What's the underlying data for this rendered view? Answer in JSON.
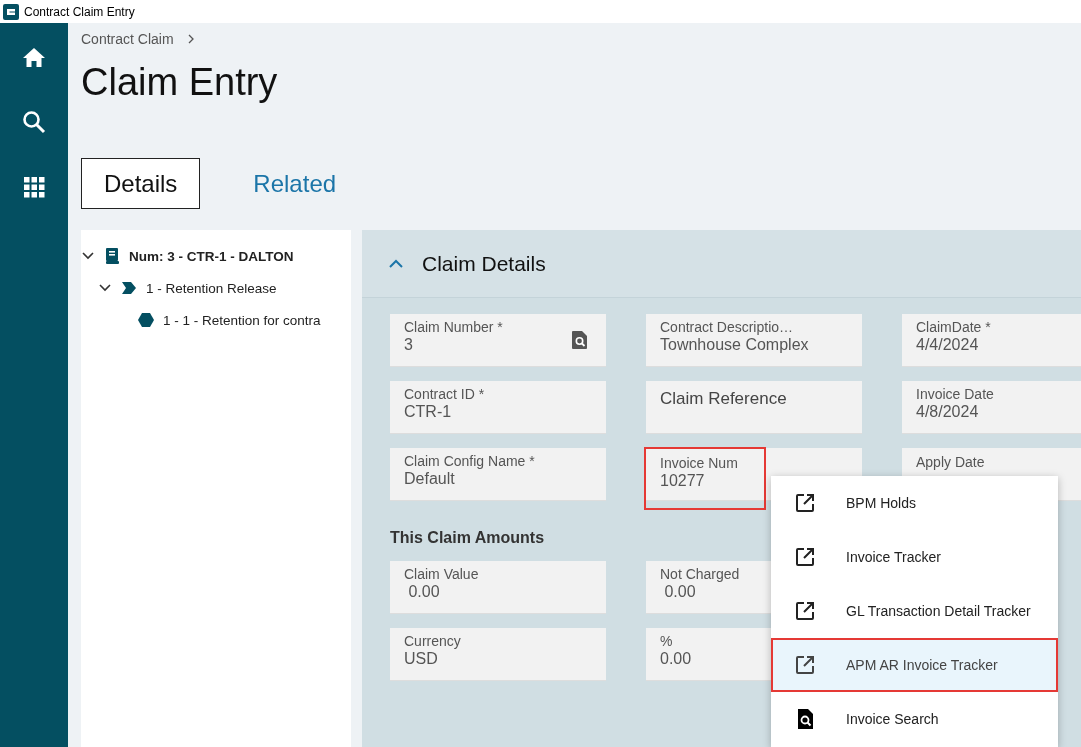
{
  "window": {
    "title": "Contract Claim Entry"
  },
  "nav": [
    {
      "kind": "home"
    },
    {
      "kind": "search"
    },
    {
      "kind": "apps"
    }
  ],
  "breadcrumb": [
    "Contract Claim"
  ],
  "page_title": "Claim Entry",
  "tabs": [
    {
      "label": "Details",
      "selected": true
    },
    {
      "label": "Related",
      "selected": false
    }
  ],
  "tree": [
    {
      "label": "Num: 3 - CTR-1 - DALTON",
      "kind": "claim",
      "expanded": true,
      "children": [
        {
          "label": "1 - Retention Release",
          "kind": "line",
          "expanded": true,
          "children": [
            {
              "label": "1 - 1 - Retention for contra",
              "kind": "item"
            }
          ]
        }
      ]
    }
  ],
  "section": {
    "title": "Claim Details",
    "expanded": true,
    "fields": [
      {
        "label": "Claim Number *",
        "value": "3",
        "lookup": true
      },
      {
        "label": "Contract Descriptio…",
        "value": "Townhouse Complex"
      },
      {
        "label": "ClaimDate *",
        "value": "4/4/2024"
      },
      {
        "label": "Contract ID *",
        "value": "CTR-1"
      },
      {
        "placeholder": "Claim Reference"
      },
      {
        "label": "Invoice Date",
        "value": "4/8/2024"
      },
      {
        "label": "Claim Config Name *",
        "value": "Default"
      },
      {
        "label": "Invoice Num",
        "value": "10277",
        "highlighted": true
      },
      {
        "label": "Apply Date"
      }
    ],
    "amounts_title": "This Claim Amounts",
    "amounts": [
      {
        "label": "Claim Value",
        "value": " 0.00"
      },
      {
        "label": "Not Charged",
        "value": " 0.00"
      },
      {
        "label": "Currency",
        "value": "USD"
      },
      {
        "label": "%",
        "value": "0.00"
      }
    ]
  },
  "menu": [
    {
      "label": "BPM Holds",
      "kind": "link",
      "highlighted": false
    },
    {
      "label": "Invoice Tracker",
      "kind": "link",
      "highlighted": false
    },
    {
      "label": "GL Transaction Detail Tracker",
      "kind": "link",
      "highlighted": false
    },
    {
      "label": "APM AR Invoice Tracker",
      "kind": "link",
      "highlighted": true
    },
    {
      "label": "Invoice Search",
      "kind": "search",
      "highlighted": false
    }
  ]
}
